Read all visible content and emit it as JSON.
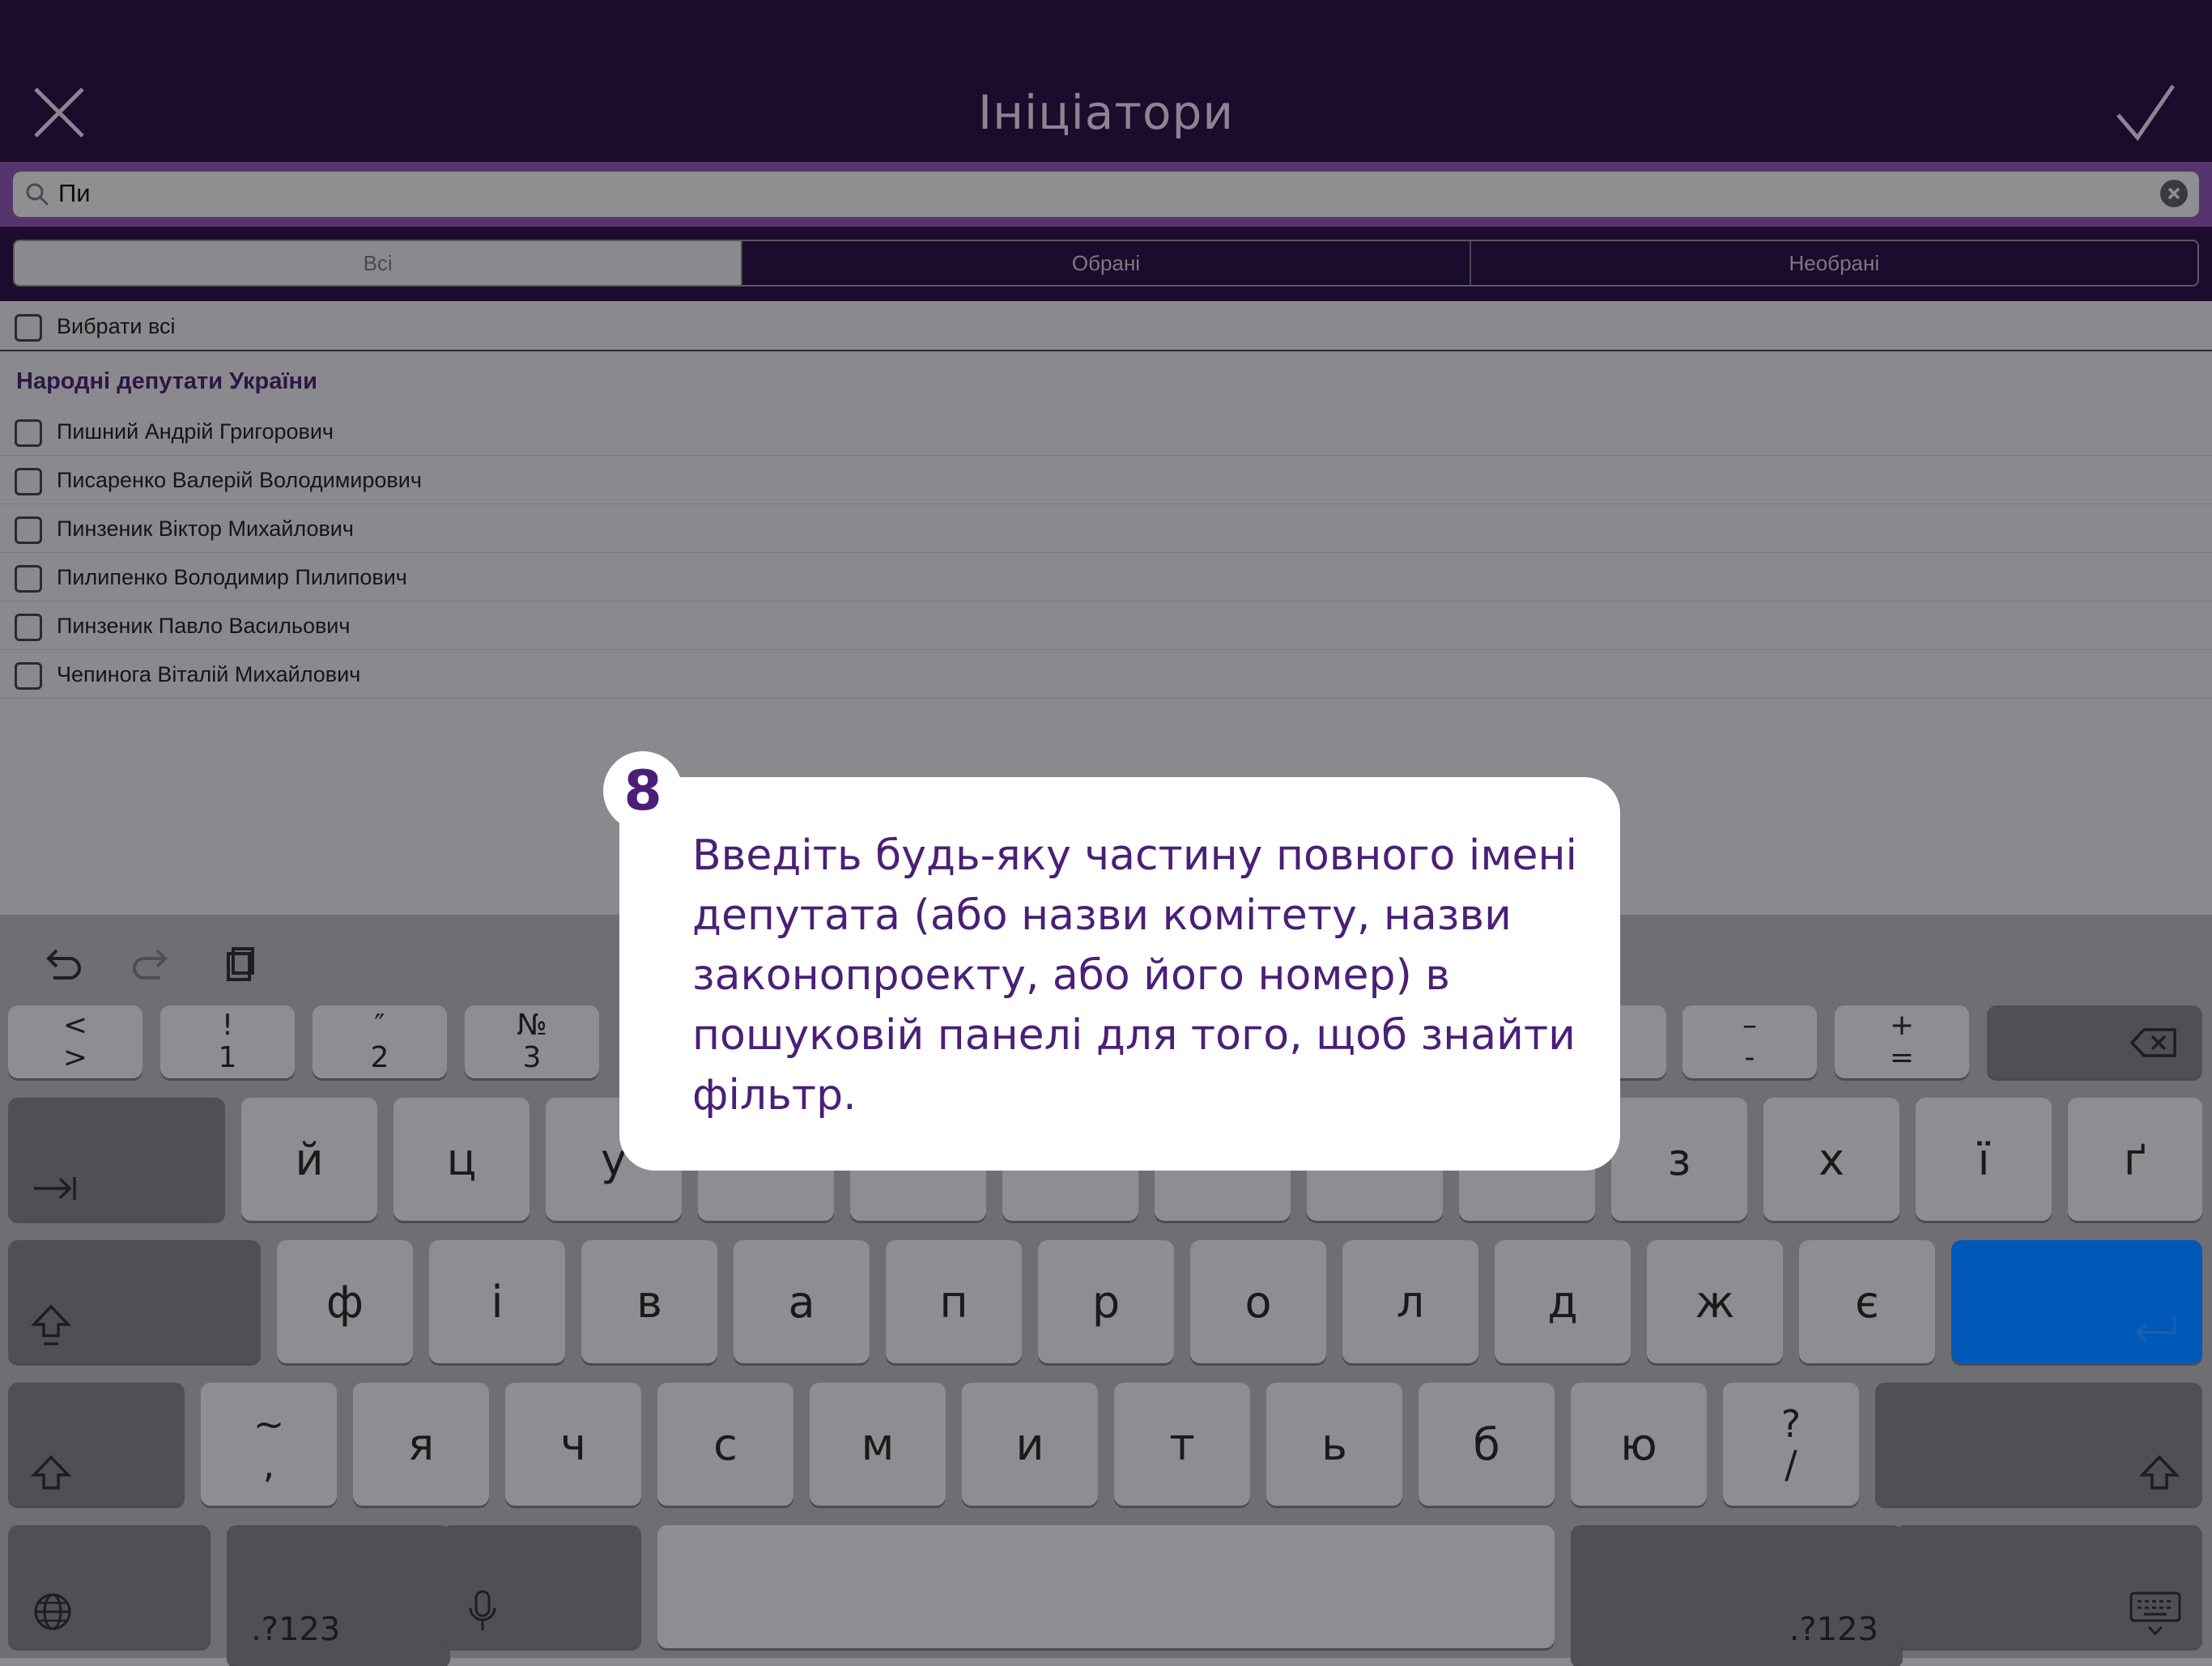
{
  "header": {
    "title": "Ініціатори"
  },
  "search": {
    "value": "Пи"
  },
  "segments": [
    "Всі",
    "Обрані",
    "Необрані"
  ],
  "list": {
    "select_all": "Вибрати всі",
    "section": "Народні депутати України",
    "items": [
      "Пишний Андрій Григорович",
      "Писаренко Валерій Володимирович",
      "Пинзеник Віктор Михайлович",
      "Пилипенко Володимир Пилипович",
      "Пинзеник Павло Васильович",
      "Чепинога Віталій Михайлович"
    ]
  },
  "tooltip": {
    "step": "8",
    "text": "Введіть будь-яку частину повного імені депутата (або назви комітету, назви законопроекту, або його номер) в пошуковій панелі для того, щоб знайти фільтр."
  },
  "keyboard": {
    "numrow": [
      {
        "top": "<",
        "bottom": ">"
      },
      {
        "top": "!",
        "bottom": "1"
      },
      {
        "top": "″",
        "bottom": "2"
      },
      {
        "top": "№",
        "bottom": "3"
      }
    ],
    "numrow_right": [
      {
        "top": "–",
        "bottom": "-"
      },
      {
        "top": "+",
        "bottom": "="
      }
    ],
    "row1_visible": [
      "й",
      "ц",
      "у"
    ],
    "row1_right": [
      "з",
      "х",
      "ї",
      "ґ"
    ],
    "row2": [
      "ф",
      "і",
      "в",
      "а",
      "п",
      "р",
      "о",
      "л",
      "д",
      "ж",
      "є"
    ],
    "row3_first": {
      "top": "~",
      "bottom": ","
    },
    "row3": [
      "я",
      "ч",
      "с",
      "м",
      "и",
      "т",
      "ь",
      "б",
      "ю"
    ],
    "row3_last": {
      "top": "?",
      "bottom": "/"
    },
    "mode_left": ".?123",
    "mode_right": ".?123"
  }
}
